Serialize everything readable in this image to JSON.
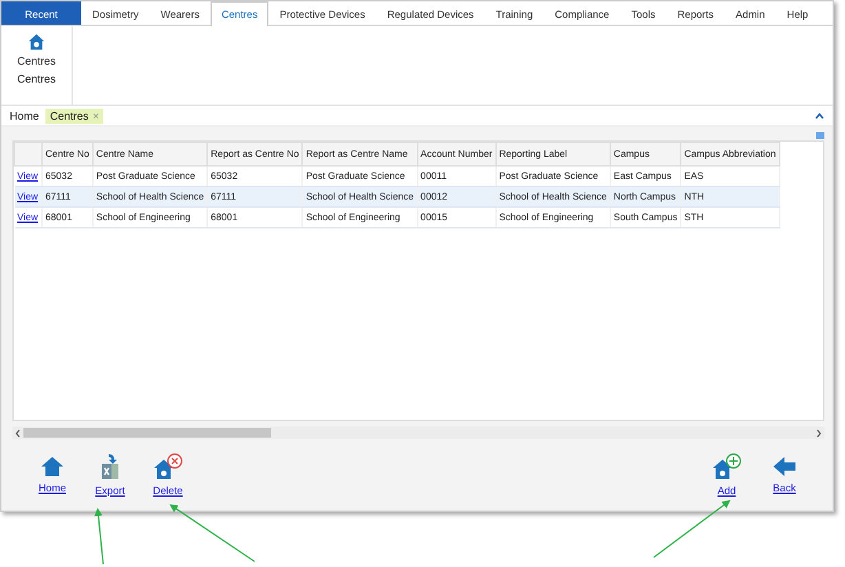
{
  "tabs": [
    {
      "label": "Recent",
      "kind": "backstage",
      "selected": false
    },
    {
      "label": "Dosimetry",
      "kind": "tab",
      "selected": false
    },
    {
      "label": "Wearers",
      "kind": "tab",
      "selected": false
    },
    {
      "label": "Centres",
      "kind": "tab",
      "selected": true
    },
    {
      "label": "Protective Devices",
      "kind": "tab",
      "selected": false
    },
    {
      "label": "Regulated Devices",
      "kind": "tab",
      "selected": false
    },
    {
      "label": "Training",
      "kind": "tab",
      "selected": false
    },
    {
      "label": "Compliance",
      "kind": "tab",
      "selected": false
    },
    {
      "label": "Tools",
      "kind": "tab",
      "selected": false
    },
    {
      "label": "Reports",
      "kind": "tab",
      "selected": false
    },
    {
      "label": "Admin",
      "kind": "tab",
      "selected": false
    },
    {
      "label": "Help",
      "kind": "tab",
      "selected": false
    }
  ],
  "ribbon": {
    "button": "Centres",
    "group": "Centres"
  },
  "breadcrumbs": [
    {
      "label": "Home",
      "selected": false
    },
    {
      "label": "Centres",
      "selected": true,
      "close": "×"
    }
  ],
  "table": {
    "columns": [
      "",
      "Centre No",
      "Centre Name",
      "Report as Centre No",
      "Report as Centre Name",
      "Account Number",
      "Reporting Label",
      "Campus",
      "Campus Abbreviation"
    ],
    "rows": [
      {
        "selected": false,
        "cells": [
          "View",
          "65032",
          "Post Graduate Science",
          "65032",
          "Post Graduate Science",
          "00011",
          "Post Graduate Science",
          "East Campus",
          "EAS"
        ]
      },
      {
        "selected": true,
        "cells": [
          "View",
          "67111",
          "School of Health Science",
          "67111",
          "School of Health Science",
          "00012",
          "School of Health Science",
          "North Campus",
          "NTH"
        ]
      },
      {
        "selected": false,
        "cells": [
          "View",
          "68001",
          "School of Engineering",
          "68001",
          "School of Engineering",
          "00015",
          "School of Engineering",
          "South Campus",
          "STH"
        ]
      }
    ]
  },
  "toolbar": {
    "left": [
      {
        "label": "Home",
        "kind": "home"
      },
      {
        "label": "Export",
        "kind": "export"
      },
      {
        "label": "Delete",
        "kind": "delete"
      }
    ],
    "right": [
      {
        "label": "Add",
        "kind": "add"
      },
      {
        "label": "Back",
        "kind": "back"
      }
    ]
  }
}
